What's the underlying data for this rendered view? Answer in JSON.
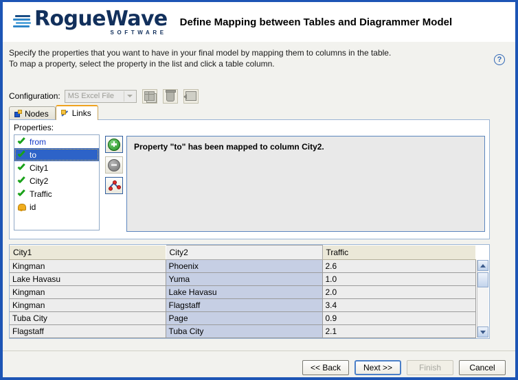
{
  "window": {
    "frame_color": "#1d55b5"
  },
  "header": {
    "logo_main": "RogueWave",
    "logo_sub": "SOFTWARE",
    "title": "Define Mapping between Tables and Diagrammer Model",
    "help_icon": "help-question-icon",
    "help_glyph": "?"
  },
  "instructions": {
    "line1": "Specify the properties that you want to have in your final model by mapping them to columns in the table.",
    "line2": "To map a property, select the property in the list and click a table column."
  },
  "config": {
    "label": "Configuration:",
    "selected_value": "MS Excel File",
    "dropdown_enabled": false,
    "buttons": [
      {
        "name": "manage-configurations-button",
        "icon": "table-copy-icon",
        "enabled": false
      },
      {
        "name": "delete-configuration-button",
        "icon": "trash-icon",
        "enabled": false
      },
      {
        "name": "import-configuration-button",
        "icon": "import-arrow-icon",
        "enabled": false
      }
    ]
  },
  "tabs": [
    {
      "label": "Nodes",
      "icon": "nodes-icon",
      "active": false
    },
    {
      "label": "Links",
      "icon": "links-icon",
      "active": true
    }
  ],
  "properties": {
    "label": "Properties:",
    "items": [
      {
        "label": "from",
        "icon": "green-check-icon",
        "state": "mapped",
        "selected": false,
        "text_color": "#1338c7"
      },
      {
        "label": "to",
        "icon": "green-check-icon",
        "state": "mapped",
        "selected": true,
        "text_color": "#ffffff"
      },
      {
        "label": "City1",
        "icon": "green-check-icon",
        "state": "mapped",
        "selected": false,
        "text_color": "#000000"
      },
      {
        "label": "City2",
        "icon": "green-check-icon",
        "state": "mapped",
        "selected": false,
        "text_color": "#000000"
      },
      {
        "label": "Traffic",
        "icon": "green-check-icon",
        "state": "mapped",
        "selected": false,
        "text_color": "#000000"
      },
      {
        "label": "id",
        "icon": "bell-warning-icon",
        "state": "unmapped",
        "selected": false,
        "text_color": "#000000"
      }
    ]
  },
  "side_buttons": [
    {
      "name": "add-property-button",
      "icon": "green-plus-icon",
      "enabled": true
    },
    {
      "name": "remove-property-button",
      "icon": "gray-minus-icon",
      "enabled": false
    },
    {
      "name": "edit-mapping-button",
      "icon": "link-graph-icon",
      "enabled": true
    }
  ],
  "message": {
    "text": "Property \"to\" has been mapped to column City2."
  },
  "table": {
    "columns": [
      {
        "label": "City1",
        "selected": false
      },
      {
        "label": "City2",
        "selected": true
      },
      {
        "label": "Traffic",
        "selected": false
      }
    ],
    "rows": [
      [
        "Kingman",
        "Phoenix",
        "2.6"
      ],
      [
        "Lake Havasu",
        "Yuma",
        "1.0"
      ],
      [
        "Kingman",
        "Lake Havasu",
        "2.0"
      ],
      [
        "Kingman",
        "Flagstaff",
        "3.4"
      ],
      [
        "Tuba City",
        "Page",
        "0.9"
      ],
      [
        "Flagstaff",
        "Tuba City",
        "2.1"
      ],
      [
        "",
        "",
        ""
      ]
    ],
    "scrollbar": {
      "up_glyph": "scroll-up-icon",
      "down_glyph": "scroll-down-icon"
    }
  },
  "footer": {
    "buttons": [
      {
        "label": "<< Back",
        "name": "back-button",
        "enabled": true,
        "default": false
      },
      {
        "label": "Next >>",
        "name": "next-button",
        "enabled": true,
        "default": true
      },
      {
        "label": "Finish",
        "name": "finish-button",
        "enabled": false,
        "default": false
      },
      {
        "label": "Cancel",
        "name": "cancel-button",
        "enabled": true,
        "default": false
      }
    ]
  }
}
